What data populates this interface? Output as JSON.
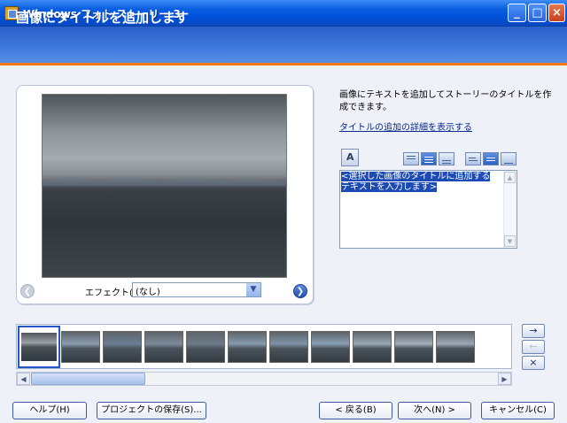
{
  "window": {
    "title": "Windows フォト ストーリー 3"
  },
  "header": {
    "title": "画像にタイトルを追加します"
  },
  "preview": {
    "effect_label": "エフェクト(E):",
    "effect_value": "(なし)"
  },
  "right_panel": {
    "instructions": "画像にテキストを追加してストーリーのタイトルを作成できます。",
    "details_link": "タイトルの追加の詳細を表示する",
    "caption_text": "<選択した画像のタイトルに追加するテキストを入力します>"
  },
  "side_buttons": {
    "move_right": "→",
    "move_left": "←",
    "remove": "×"
  },
  "buttons": {
    "help": "ヘルプ(H)",
    "save_project": "プロジェクトの保存(S)...",
    "back": "< 戻る(B)",
    "next": "次へ(N) >",
    "cancel": "キャンセル(C)"
  },
  "thumbnail_colors": [
    "#8a9cae",
    "#6a7f95",
    "#7d8b9a",
    "#6c7a88",
    "#869aae",
    "#7f93a8",
    "#8aa0b5",
    "#9aa8b7",
    "#a4aebb",
    "#9ea8b4",
    "#b3b9c4"
  ]
}
